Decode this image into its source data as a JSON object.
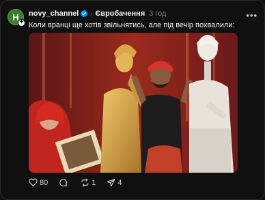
{
  "post": {
    "avatar_letter": "H",
    "username": "novy_channel",
    "topic": "Євробачення",
    "time": "3 год",
    "caption": "Коли вранці ще хотів звільнятись, але під вечір похвалили:",
    "image_alt": "Eurovision stage performance photo with performers in costumes",
    "actions": {
      "likes": "80",
      "comments": "",
      "reposts": "1",
      "shares": "4"
    }
  },
  "colors": {
    "background": "#101010",
    "text": "#f3f5f7",
    "muted": "#777777",
    "verified": "#0095f6",
    "avatar": "#3f7a34"
  }
}
